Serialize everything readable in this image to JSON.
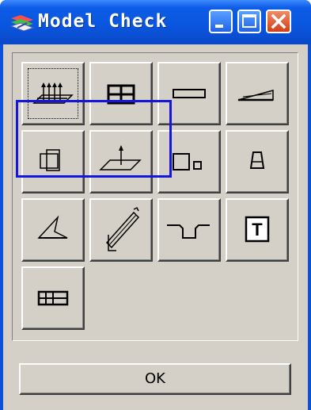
{
  "window": {
    "title": "Model Check",
    "icon": "app-model-icon",
    "controls": [
      {
        "name": "minimize",
        "icon": "minimize-icon"
      },
      {
        "name": "maximize",
        "icon": "maximize-icon"
      },
      {
        "name": "close",
        "icon": "close-icon"
      }
    ]
  },
  "toolbar": {
    "buttons": [
      {
        "icon": "grid-points-plane-icon",
        "selected": true
      },
      {
        "icon": "grid-cells-icon"
      },
      {
        "icon": "rectangle-icon"
      },
      {
        "icon": "slope-plate-icon"
      },
      {
        "icon": "overlap-squares-icon"
      },
      {
        "icon": "plane-load-icon"
      },
      {
        "icon": "squares-size-icon"
      },
      {
        "icon": "trapezoid-icon"
      },
      {
        "icon": "angle-icon"
      },
      {
        "icon": "stair-ramp-icon"
      },
      {
        "icon": "step-profile-icon"
      },
      {
        "icon": "text-t-icon",
        "text": "T"
      },
      {
        "icon": "multi-grid-icon"
      }
    ]
  },
  "footer": {
    "ok_label": "OK"
  },
  "colors": {
    "titlebar": "#0a55dd",
    "face": "#d4d0c8",
    "highlight": "#1515e0",
    "close": "#d43c18"
  }
}
